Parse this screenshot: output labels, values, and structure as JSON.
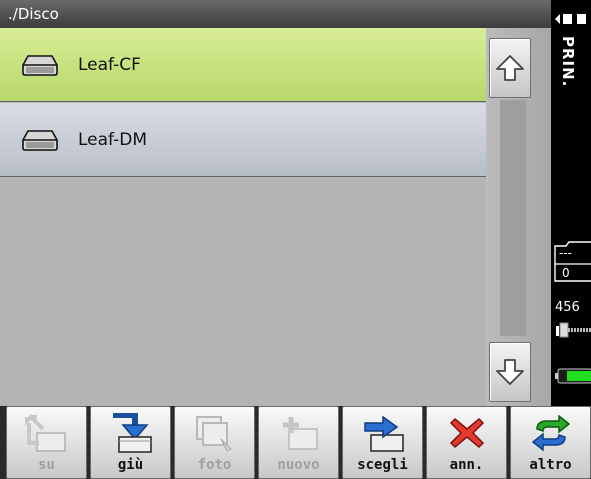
{
  "title": "./Disco",
  "items": [
    {
      "label": "Leaf-CF",
      "icon": "drive-icon",
      "selected": true
    },
    {
      "label": "Leaf-DM",
      "icon": "drive-icon",
      "selected": false
    }
  ],
  "scroll": {
    "up_icon": "arrow-up-icon",
    "down_icon": "arrow-down-icon"
  },
  "sidebar": {
    "mode_label": "PRIN.",
    "folder_text": "---",
    "folder_count": "0",
    "shots_remaining": "456"
  },
  "toolbar": [
    {
      "label": "su",
      "icon": "folder-up-icon",
      "enabled": false
    },
    {
      "label": "giù",
      "icon": "folder-down-icon",
      "enabled": true
    },
    {
      "label": "foto",
      "icon": "photo-icon",
      "enabled": false
    },
    {
      "label": "nuovo",
      "icon": "new-folder-icon",
      "enabled": false
    },
    {
      "label": "scegli",
      "icon": "choose-icon",
      "enabled": true
    },
    {
      "label": "ann.",
      "icon": "cancel-icon",
      "enabled": true
    },
    {
      "label": "altro",
      "icon": "swap-icon",
      "enabled": true
    }
  ],
  "colors": {
    "selected_row": "#c6e07c",
    "normal_row": "#c8ccd4",
    "background": "#b4b4b4",
    "battery": "#22dd22"
  }
}
